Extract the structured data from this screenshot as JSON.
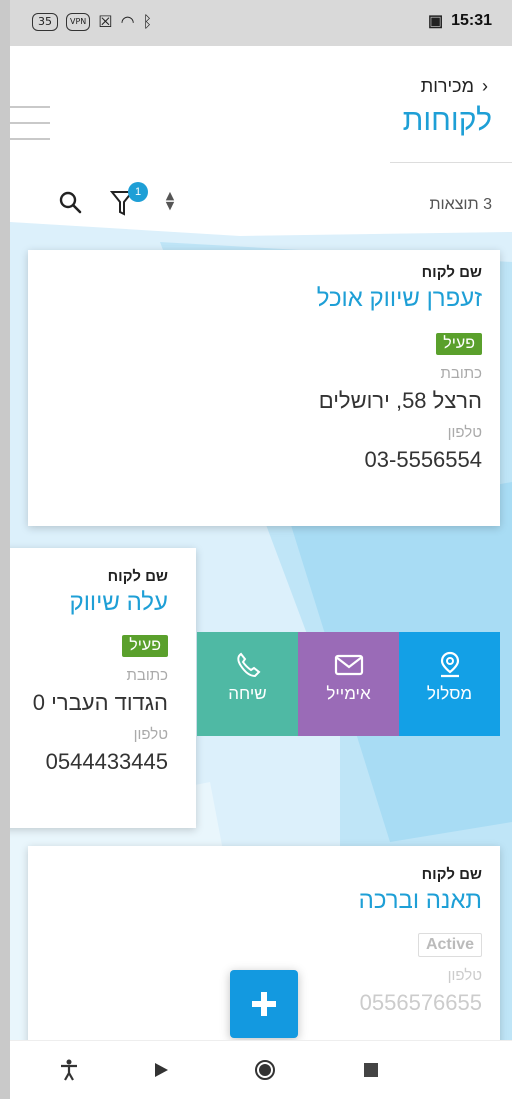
{
  "status_bar": {
    "battery": "35",
    "vpn": "VPN",
    "time": "15:31"
  },
  "header": {
    "breadcrumb": "מכירות",
    "title": "לקוחות",
    "results_count": "3 תוצאות",
    "filter_count": "1"
  },
  "cards": [
    {
      "name_label": "שם לקוח",
      "name": "זעפרן שיווק אוכל",
      "status": "פעיל",
      "address_label": "כתובת",
      "address": "הרצל 58, ירושלים",
      "phone_label": "טלפון",
      "phone": "03-5556554"
    },
    {
      "name_label": "שם לקוח",
      "name": "עלה שיווק",
      "status": "פעיל",
      "address_label": "כתובת",
      "address": "הגדוד העברי 0",
      "phone_label": "טלפון",
      "phone": "0544433445"
    },
    {
      "name_label": "שם לקוח",
      "name": "תאנה וברכה",
      "status": "Active",
      "phone_label": "טלפון",
      "phone": "0556576655"
    }
  ],
  "actions": {
    "call": "שיחה",
    "email": "אימייל",
    "route": "מסלול"
  },
  "colors": {
    "accent": "#1e9fd6",
    "active_badge": "#5aa02c",
    "call": "#4fb9a4",
    "email": "#9a6bb7",
    "route": "#13a0e6"
  }
}
